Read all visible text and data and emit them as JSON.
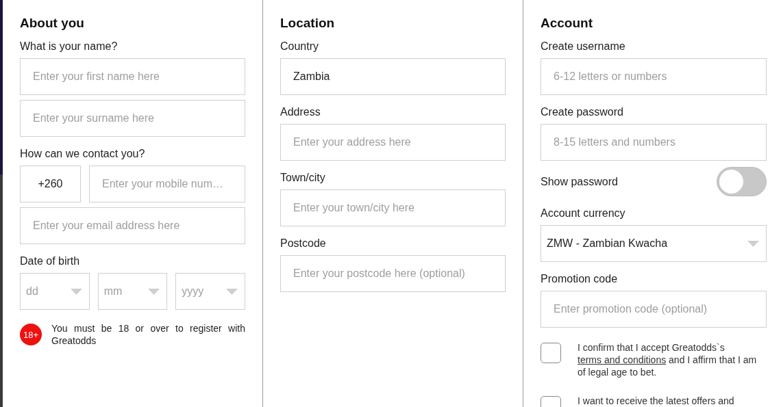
{
  "sections": [
    {
      "title": "About you",
      "items": [
        {
          "kind": "label",
          "text": "What is your name?"
        },
        {
          "kind": "input",
          "placeholder": "Enter your first name here"
        },
        {
          "kind": "input",
          "placeholder": "Enter your surname here"
        },
        {
          "kind": "label",
          "text": "How can we contact you?"
        },
        {
          "kind": "phone",
          "code": "+260",
          "placeholder": "Enter your mobile num…"
        },
        {
          "kind": "input",
          "placeholder": "Enter your email address here"
        },
        {
          "kind": "label",
          "text": "Date of birth"
        },
        {
          "kind": "date",
          "selects": [
            {
              "placeholder": "dd"
            },
            {
              "placeholder": "mm"
            },
            {
              "placeholder": "yyyy"
            }
          ]
        },
        {
          "kind": "notice",
          "badge": "18+",
          "text": "You must be 18 or over to register with Greatodds"
        }
      ]
    },
    {
      "title": "Location",
      "items": [
        {
          "kind": "label",
          "text": "Country"
        },
        {
          "kind": "input",
          "value": "Zambia"
        },
        {
          "kind": "label",
          "text": "Address"
        },
        {
          "kind": "input",
          "placeholder": "Enter your address here"
        },
        {
          "kind": "label",
          "text": "Town/city"
        },
        {
          "kind": "input",
          "placeholder": "Enter your town/city here"
        },
        {
          "kind": "label",
          "text": "Postcode"
        },
        {
          "kind": "input",
          "placeholder": "Enter your postcode here (optional)"
        }
      ]
    },
    {
      "title": "Account",
      "items": [
        {
          "kind": "label",
          "text": "Create username"
        },
        {
          "kind": "input",
          "placeholder": "6-12 letters or numbers"
        },
        {
          "kind": "label",
          "text": "Create password"
        },
        {
          "kind": "input",
          "placeholder": "8-15 letters and numbers"
        },
        {
          "kind": "toggle",
          "label": "Show password",
          "on": false
        },
        {
          "kind": "label",
          "text": "Account currency"
        },
        {
          "kind": "select",
          "value": "ZMW - Zambian Kwacha"
        },
        {
          "kind": "label",
          "text": "Promotion code"
        },
        {
          "kind": "input",
          "placeholder": "Enter promotion code (optional)"
        },
        {
          "kind": "checkbox",
          "checked": false,
          "before": "I confirm that I accept Greatodds`s ",
          "link": "terms and conditions",
          "after": " and I affirm that I am of legal age to bet."
        },
        {
          "kind": "checkbox",
          "checked": false,
          "before": "I want to receive the latest offers and"
        }
      ]
    }
  ]
}
